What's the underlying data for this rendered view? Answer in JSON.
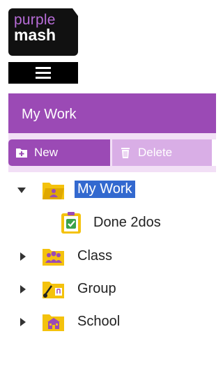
{
  "logo": {
    "line1": "purple",
    "line2": "mash"
  },
  "panel": {
    "title": "My Work"
  },
  "toolbar": {
    "new_label": "New",
    "delete_label": "Delete"
  },
  "tree": [
    {
      "label": "My Work",
      "expanded": true,
      "selected": true,
      "icon": "my-work-folder-icon"
    },
    {
      "label": "Done 2dos",
      "icon": "clipboard-check-icon"
    },
    {
      "label": "Class",
      "expanded": false,
      "icon": "people-folder-icon"
    },
    {
      "label": "Group",
      "expanded": false,
      "icon": "music-folder-icon"
    },
    {
      "label": "School",
      "expanded": false,
      "icon": "school-folder-icon"
    }
  ],
  "colors": {
    "brand_purple": "#9b4ab5",
    "toolbar_bg": "#f2dff6",
    "delete_disabled": "#d9aee6",
    "selection": "#3369cf",
    "folder_yellow": "#f4c20d"
  }
}
